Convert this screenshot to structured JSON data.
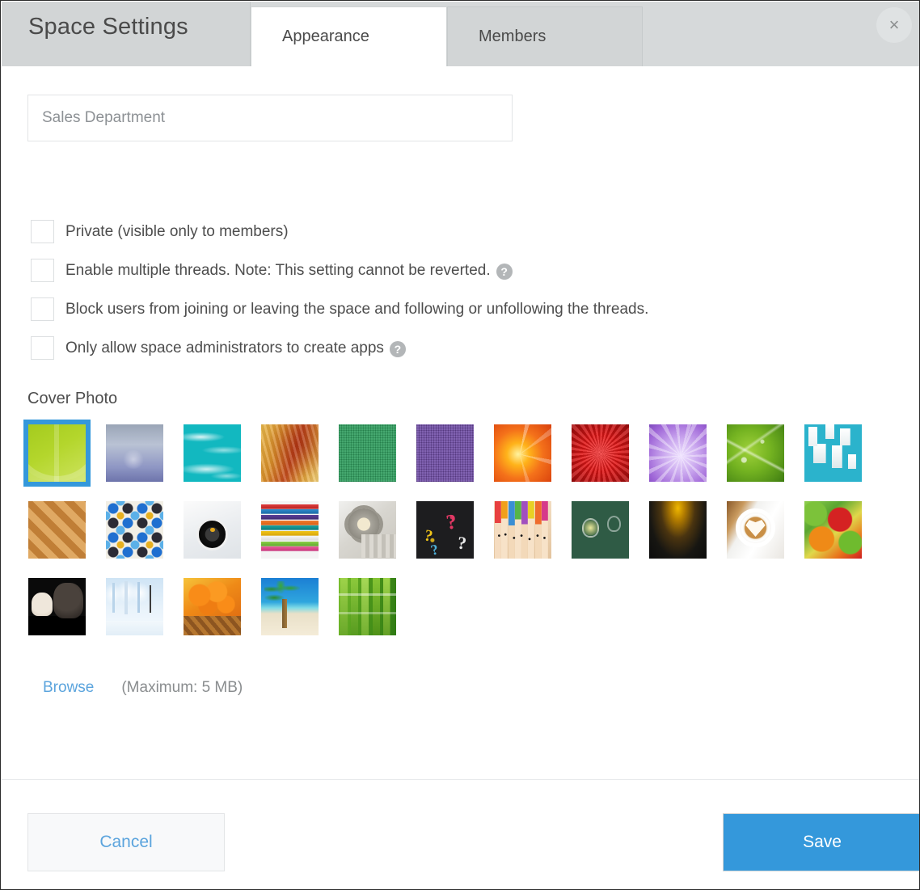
{
  "dialog": {
    "title": "Space Settings",
    "close_label": "×"
  },
  "tabs": [
    {
      "id": "appearance",
      "label": "Appearance",
      "active": true
    },
    {
      "id": "members",
      "label": "Members",
      "active": false
    }
  ],
  "form": {
    "space_name_value": "Sales Department",
    "space_name_placeholder": "Sales Department",
    "checkboxes": [
      {
        "id": "private",
        "label": "Private (visible only to members)",
        "checked": false,
        "help": false
      },
      {
        "id": "multiple-threads",
        "label": "Enable multiple threads. Note: This setting cannot be reverted.",
        "checked": false,
        "help": true,
        "help_glyph": "?"
      },
      {
        "id": "block-users",
        "label": "Block users from joining or leaving the space and following or unfollowing the threads.",
        "checked": false,
        "help": false
      },
      {
        "id": "admin-apps",
        "label": "Only allow space administrators to create apps",
        "checked": false,
        "help": true,
        "help_glyph": "?"
      }
    ]
  },
  "cover_photo": {
    "section_label": "Cover Photo",
    "browse_label": "Browse",
    "max_size_note": "(Maximum: 5 MB)",
    "selected_index": 0,
    "thumbnails": [
      {
        "name": "green-card",
        "art": "a-green-card"
      },
      {
        "name": "blue-blur",
        "art": "a-blue-blur"
      },
      {
        "name": "teal-water",
        "art": "a-teal-water"
      },
      {
        "name": "rust-paper",
        "art": "a-rust-paper"
      },
      {
        "name": "green-felt",
        "art": "a-green-felt"
      },
      {
        "name": "purple-felt",
        "art": "a-purple-felt"
      },
      {
        "name": "orange-lily",
        "art": "a-orange-lily"
      },
      {
        "name": "red-carnation",
        "art": "a-red-carnation"
      },
      {
        "name": "purple-flower",
        "art": "a-purple-flower"
      },
      {
        "name": "green-leaf-dew",
        "art": "a-green-leaf"
      },
      {
        "name": "blue-blocks",
        "art": "a-blue-blocks"
      },
      {
        "name": "wood-parquet",
        "art": "a-wood"
      },
      {
        "name": "blue-tile-mosaic",
        "art": "a-tile"
      },
      {
        "name": "compass-map",
        "art": "a-compass"
      },
      {
        "name": "stacked-books",
        "art": "a-books"
      },
      {
        "name": "gears-tools",
        "art": "a-gears"
      },
      {
        "name": "chalkboard-question-marks",
        "art": "a-chalkboard"
      },
      {
        "name": "colored-pencils",
        "art": "a-pencils"
      },
      {
        "name": "lightbulb-chalkboard",
        "art": "a-bulb"
      },
      {
        "name": "dark-gold-gradient",
        "art": "a-dark-gradient"
      },
      {
        "name": "latte-art-coffee",
        "art": "a-latte"
      },
      {
        "name": "vegetables",
        "art": "a-veggies"
      },
      {
        "name": "cat-and-dog",
        "art": "a-pets"
      },
      {
        "name": "snowy-trees",
        "art": "a-snow"
      },
      {
        "name": "pumpkin-basket",
        "art": "a-pumpkins"
      },
      {
        "name": "palm-tree-beach",
        "art": "a-beach"
      },
      {
        "name": "bamboo",
        "art": "a-bamboo"
      }
    ]
  },
  "footer": {
    "cancel_label": "Cancel",
    "save_label": "Save"
  },
  "colors": {
    "accent_blue": "#3498db",
    "link_blue": "#5ba4dd",
    "header_grey": "#d2d5d6",
    "text_grey": "#4d4d4d"
  }
}
